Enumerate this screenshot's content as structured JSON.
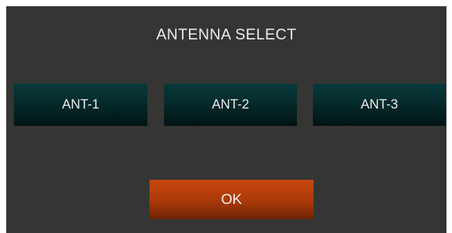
{
  "dialog": {
    "title": "ANTENNA SELECT",
    "antennas": [
      {
        "label": "ANT-1"
      },
      {
        "label": "ANT-2"
      },
      {
        "label": "ANT-3"
      }
    ],
    "ok_label": "OK"
  },
  "colors": {
    "dialog_background": "#353634",
    "antenna_button": "#052b2c",
    "ok_button": "#b53f0b",
    "text": "#ececec"
  }
}
